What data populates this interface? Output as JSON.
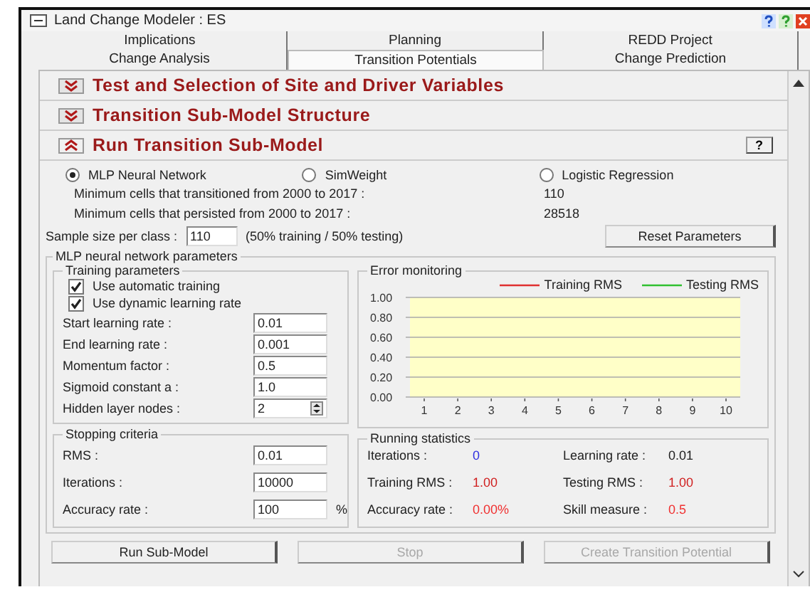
{
  "window": {
    "title": "Land Change Modeler : ES"
  },
  "tab_rows": [
    [
      {
        "label": "Implications",
        "selected": false
      },
      {
        "label": "Planning",
        "selected": false
      },
      {
        "label": "REDD Project",
        "selected": false
      }
    ],
    [
      {
        "label": "Change Analysis",
        "selected": false
      },
      {
        "label": "Transition Potentials",
        "selected": true
      },
      {
        "label": "Change Prediction",
        "selected": false
      }
    ]
  ],
  "sections": [
    {
      "title": "Test and Selection of Site and Driver Variables",
      "expanded": false
    },
    {
      "title": "Transition Sub-Model Structure",
      "expanded": false
    },
    {
      "title": "Run Transition Sub-Model",
      "expanded": true,
      "help": "?"
    }
  ],
  "methods": [
    {
      "label": "MLP Neural Network",
      "selected": true
    },
    {
      "label": "SimWeight",
      "selected": false
    },
    {
      "label": "Logistic Regression",
      "selected": false
    }
  ],
  "cell_info": [
    {
      "label": "Minimum cells that transitioned from 2000 to 2017 :",
      "value": "110"
    },
    {
      "label": "Minimum cells that persisted from 2000 to 2017 :",
      "value": "28518"
    }
  ],
  "sample": {
    "label": "Sample size per class :",
    "value": "110",
    "note": "(50% training / 50% testing)",
    "reset_button": "Reset Parameters"
  },
  "mlp": {
    "title": "MLP neural network parameters",
    "training": {
      "title": "Training parameters",
      "checks": [
        {
          "label": "Use automatic training",
          "checked": true
        },
        {
          "label": "Use dynamic learning rate",
          "checked": true
        }
      ],
      "fields": [
        {
          "label": "Start learning rate :",
          "value": "0.01",
          "kind": "text"
        },
        {
          "label": "End learning rate :",
          "value": "0.001",
          "kind": "text"
        },
        {
          "label": "Momentum factor :",
          "value": "0.5",
          "kind": "text"
        },
        {
          "label": "Sigmoid constant a :",
          "value": "1.0",
          "kind": "text"
        },
        {
          "label": "Hidden layer nodes :",
          "value": "2",
          "kind": "spinner"
        }
      ]
    },
    "error": {
      "title": "Error monitoring",
      "chart_data": {
        "type": "line",
        "grid": true,
        "categories": [
          "1",
          "2",
          "3",
          "4",
          "5",
          "6",
          "7",
          "8",
          "9",
          "10"
        ],
        "ylim": [
          0,
          1
        ],
        "yticks": [
          {
            "value": 0,
            "label": "0.00"
          },
          {
            "value": 0.2,
            "label": "0.20"
          },
          {
            "value": 0.4,
            "label": "0.40"
          },
          {
            "value": 0.6,
            "label": "0.60"
          },
          {
            "value": 0.8,
            "label": "0.80"
          },
          {
            "value": 1,
            "label": "1.00"
          }
        ],
        "series": [
          {
            "name": "Training RMS",
            "color": "#e03030",
            "values": [
              null,
              null,
              null,
              null,
              null,
              null,
              null,
              null,
              null,
              null
            ]
          },
          {
            "name": "Testing RMS",
            "color": "#30c030",
            "values": [
              null,
              null,
              null,
              null,
              null,
              null,
              null,
              null,
              null,
              null
            ]
          }
        ]
      }
    },
    "stopping": {
      "title": "Stopping criteria",
      "fields": [
        {
          "label": "RMS :",
          "value": "0.01"
        },
        {
          "label": "Iterations :",
          "value": "10000"
        },
        {
          "label": "Accuracy rate :",
          "value": "100",
          "unit": "%"
        }
      ]
    },
    "running": {
      "title": "Running statistics",
      "stats": [
        {
          "label": "Iterations :",
          "value": "0",
          "color": "#3030e0"
        },
        {
          "label": "Learning rate :",
          "value": "0.01",
          "color": "#202020"
        },
        {
          "label": "Training RMS :",
          "value": "1.00",
          "color": "#d02020"
        },
        {
          "label": "Testing RMS :",
          "value": "1.00",
          "color": "#d02020"
        },
        {
          "label": "Accuracy rate :",
          "value": "0.00%",
          "color": "#f03030"
        },
        {
          "label": "Skill measure :",
          "value": "0.5",
          "color": "#f03030"
        }
      ]
    }
  },
  "buttons": [
    {
      "label": "Run Sub-Model",
      "disabled": false
    },
    {
      "label": "Stop",
      "disabled": true
    },
    {
      "label": "Create Transition Potential",
      "disabled": true
    }
  ]
}
